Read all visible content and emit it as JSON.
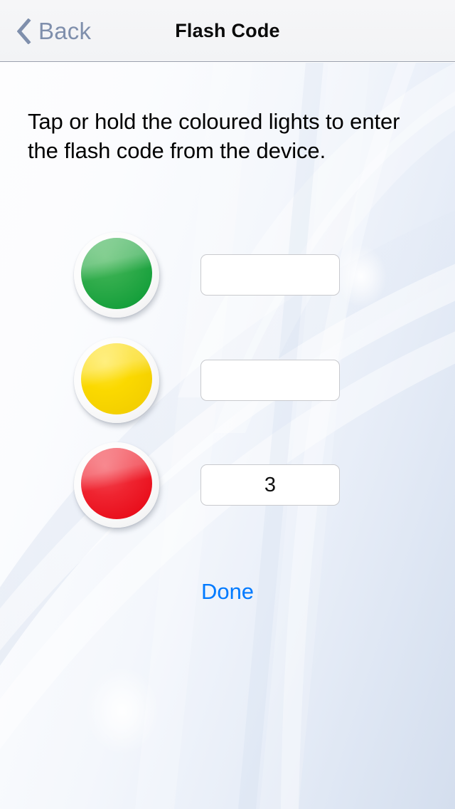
{
  "navbar": {
    "back_label": "Back",
    "back_icon": "chevron-left-icon",
    "title": "Flash Code"
  },
  "main": {
    "instructions": "Tap or hold the coloured lights to enter the flash code from the device.",
    "done_label": "Done",
    "lights": [
      {
        "name": "green",
        "color": "#2eab4a",
        "value": ""
      },
      {
        "name": "yellow",
        "color": "#fbd900",
        "value": ""
      },
      {
        "name": "red",
        "color": "#ef2430",
        "value": "3"
      }
    ]
  },
  "colors": {
    "accent_blue": "#007aff",
    "back_tint": "#7f8fac",
    "navbar_bg": "#f4f4f6",
    "field_border": "#c9cace",
    "text": "#000000"
  }
}
